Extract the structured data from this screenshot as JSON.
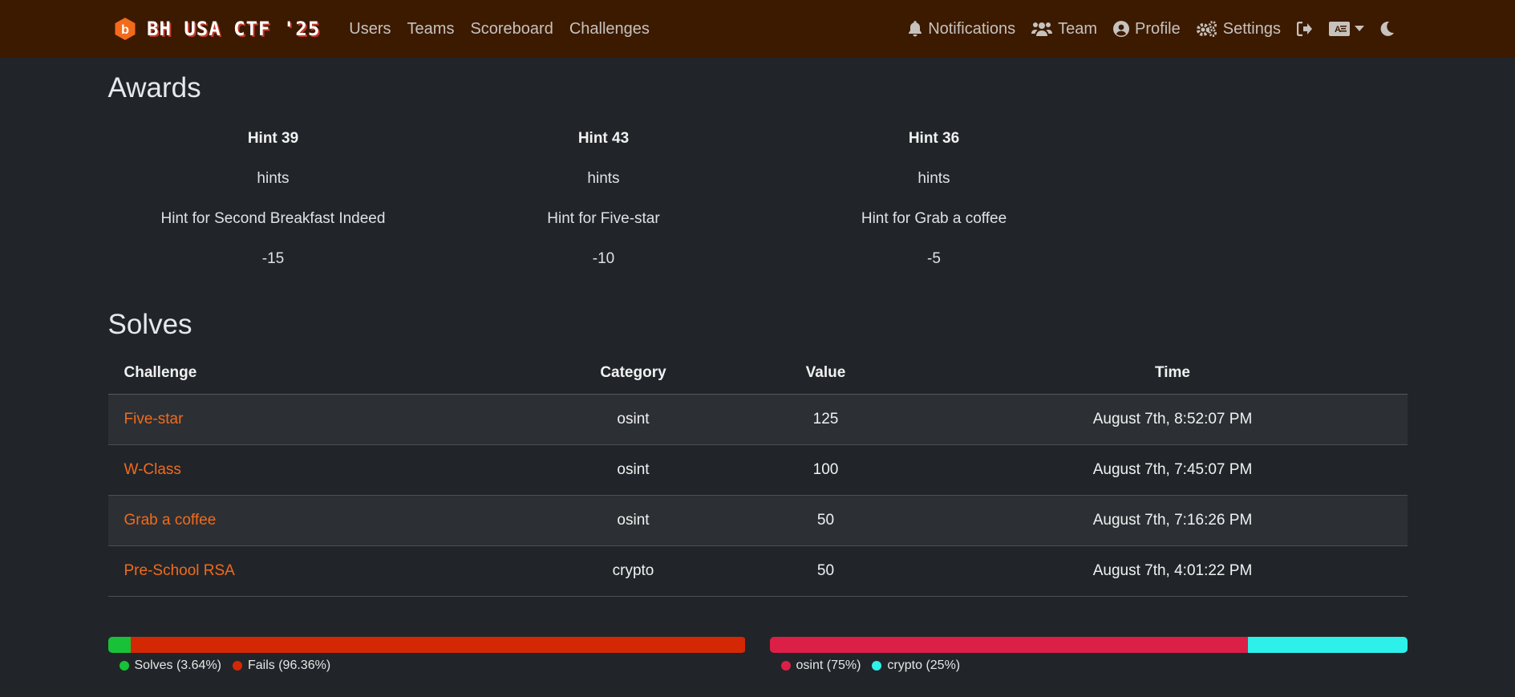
{
  "navbar": {
    "brand": "BH USA CTF '25",
    "links": [
      "Users",
      "Teams",
      "Scoreboard",
      "Challenges"
    ],
    "right": {
      "notifications": "Notifications",
      "team": "Team",
      "profile": "Profile",
      "settings": "Settings"
    },
    "icons": {
      "logo": "bh-logo-icon",
      "notifications": "bell-icon",
      "team": "users-icon",
      "profile": "user-circle-icon",
      "settings": "cogs-icon",
      "logout": "sign-out-icon",
      "language": "language-icon",
      "theme": "moon-icon"
    },
    "colors": {
      "background": "#3b1a00",
      "brand_accent": "#f26a1b"
    }
  },
  "awards": {
    "title": "Awards",
    "items": [
      {
        "name": "Hint 39",
        "category": "hints",
        "description": "Hint for Second Breakfast Indeed",
        "value": "-15"
      },
      {
        "name": "Hint 43",
        "category": "hints",
        "description": "Hint for Five-star",
        "value": "-10"
      },
      {
        "name": "Hint 36",
        "category": "hints",
        "description": "Hint for Grab a coffee",
        "value": "-5"
      }
    ]
  },
  "solves": {
    "title": "Solves",
    "headers": {
      "challenge": "Challenge",
      "category": "Category",
      "value": "Value",
      "time": "Time"
    },
    "rows": [
      {
        "challenge": "Five-star",
        "category": "osint",
        "value": "125",
        "time": "August 7th, 8:52:07 PM"
      },
      {
        "challenge": "W-Class",
        "category": "osint",
        "value": "100",
        "time": "August 7th, 7:45:07 PM"
      },
      {
        "challenge": "Grab a coffee",
        "category": "osint",
        "value": "50",
        "time": "August 7th, 7:16:26 PM"
      },
      {
        "challenge": "Pre-School RSA",
        "category": "crypto",
        "value": "50",
        "time": "August 7th, 4:01:22 PM"
      }
    ]
  },
  "stats": {
    "solve_fail": [
      {
        "label": "Solves (3.64%)",
        "fraction": 0.0364,
        "color": "#19c138"
      },
      {
        "label": "Fails (96.36%)",
        "fraction": 0.9636,
        "color": "#d42805"
      }
    ],
    "categories": [
      {
        "label": "osint (75%)",
        "fraction": 0.75,
        "color": "#dc1f47"
      },
      {
        "label": "crypto (25%)",
        "fraction": 0.25,
        "color": "#2ef0ea"
      }
    ]
  }
}
